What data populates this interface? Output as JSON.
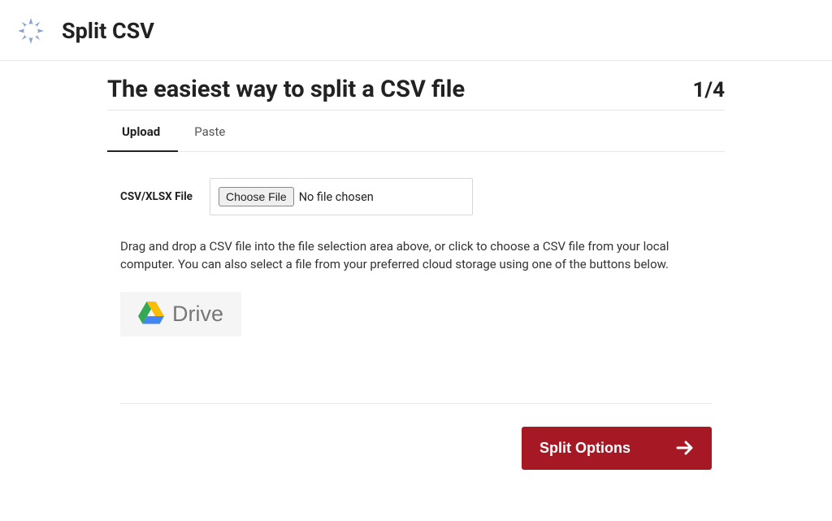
{
  "header": {
    "title": "Split CSV"
  },
  "main": {
    "heading": "The easiest way to split a CSV file",
    "step": "1/4",
    "tabs": [
      {
        "label": "Upload",
        "active": true
      },
      {
        "label": "Paste",
        "active": false
      }
    ],
    "file_label": "CSV/XLSX File",
    "choose_file_label": "Choose File",
    "no_file_text": "No file chosen",
    "help_text": "Drag and drop a CSV file into the file selection area above, or click to choose a CSV file from your local computer. You can also select a file from your preferred cloud storage using one of the buttons below.",
    "drive_label": "Drive"
  },
  "footer": {
    "split_options_label": "Split Options"
  }
}
